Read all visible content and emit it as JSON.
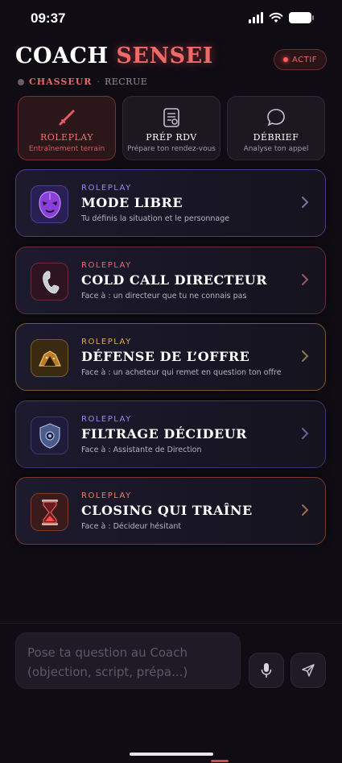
{
  "status_bar": {
    "time": "09:37"
  },
  "header": {
    "title_main": "COACH",
    "title_accent": "SENSEI",
    "status_pill": "ACTIF",
    "rank_name": "CHASSEUR",
    "rank_separator": "·",
    "rank_level": "RECRUE"
  },
  "tabs": [
    {
      "label": "ROLEPLAY",
      "sub": "Entraînement terrain",
      "icon": "sword-icon"
    },
    {
      "label": "PRÉP RDV",
      "sub": "Prépare ton rendez-vous",
      "icon": "notepad-icon"
    },
    {
      "label": "DÉBRIEF",
      "sub": "Analyse ton appel",
      "icon": "chat-bubble-icon"
    }
  ],
  "cards": [
    {
      "tag": "ROLEPLAY",
      "title": "MODE LIBRE",
      "desc": "Tu définis la situation et le personnage",
      "icon": "mask-icon",
      "color": "#6a4fd0",
      "tag_color": "#9d86f0"
    },
    {
      "tag": "ROLEPLAY",
      "title": "COLD CALL DIRECTEUR",
      "desc": "Face à : un directeur que tu ne connais pas",
      "icon": "phone-icon",
      "color": "#7a3346",
      "tag_color": "#e86a72"
    },
    {
      "tag": "ROLEPLAY",
      "title": "DÉFENSE DE L’OFFRE",
      "desc": "Face à : un acheteur qui remet en question ton offre",
      "icon": "shield-gold-icon",
      "color": "#7a5a2a",
      "tag_color": "#e0a850"
    },
    {
      "tag": "ROLEPLAY",
      "title": "FILTRAGE DÉCIDEUR",
      "desc": "Face à : Assistante de Direction",
      "icon": "crest-icon",
      "color": "#473e7a",
      "tag_color": "#9d86f0"
    },
    {
      "tag": "ROLEPLAY",
      "title": "CLOSING QUI TRAÎNE",
      "desc": "Face à : Décideur hésitant",
      "icon": "hourglass-icon",
      "color": "#7a3a2e",
      "tag_color": "#ee7f62"
    }
  ],
  "chat": {
    "placeholder": "Pose ta question au Coach (objection, script, prépa...)"
  },
  "colors": {
    "accent": "#f06a6a",
    "background": "#0f0c14"
  }
}
